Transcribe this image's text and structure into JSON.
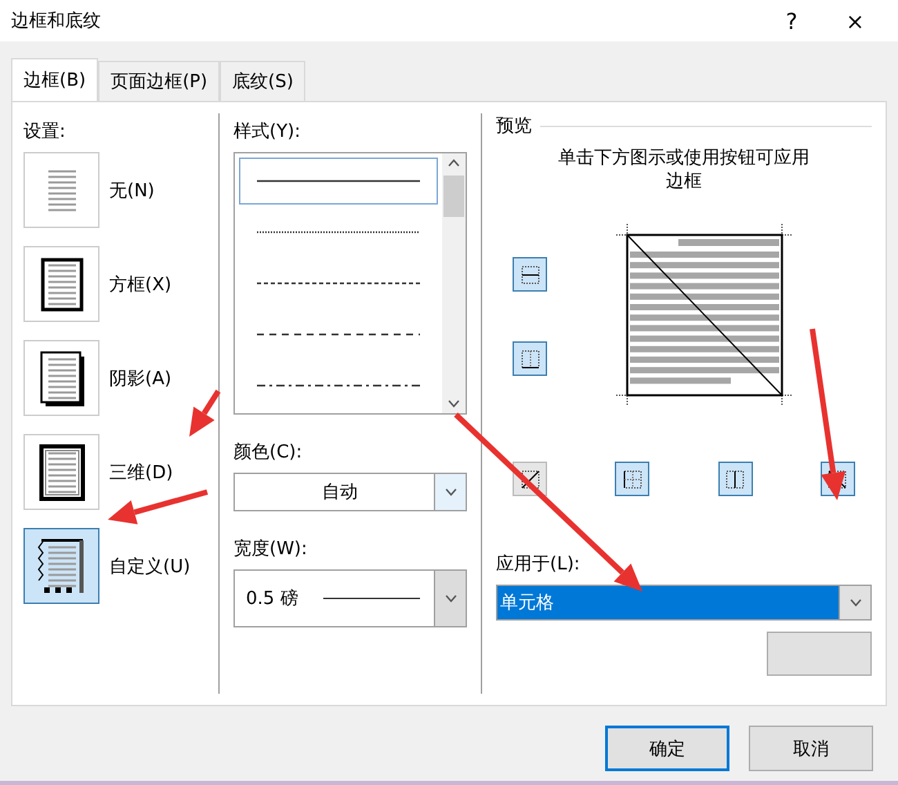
{
  "window": {
    "title": "边框和底纹",
    "help": "?",
    "close": "×"
  },
  "tabs": [
    {
      "label": "边框(B)",
      "selected": true
    },
    {
      "label": "页面边框(P)",
      "selected": false
    },
    {
      "label": "底纹(S)",
      "selected": false
    }
  ],
  "settings": {
    "label": "设置:",
    "items": [
      {
        "label": "无(N)",
        "kind": "none",
        "selected": false
      },
      {
        "label": "方框(X)",
        "kind": "box",
        "selected": false
      },
      {
        "label": "阴影(A)",
        "kind": "shadow",
        "selected": false
      },
      {
        "label": "三维(D)",
        "kind": "threed",
        "selected": false
      },
      {
        "label": "自定义(U)",
        "kind": "custom",
        "selected": true
      }
    ]
  },
  "style": {
    "label": "样式(Y):",
    "items": [
      {
        "kind": "solid",
        "selected": true
      },
      {
        "kind": "dotted",
        "selected": false
      },
      {
        "kind": "dashed-small",
        "selected": false
      },
      {
        "kind": "dashed",
        "selected": false
      },
      {
        "kind": "dash-dot",
        "selected": false
      }
    ]
  },
  "color": {
    "label": "颜色(C):",
    "value": "自动"
  },
  "width": {
    "label": "宽度(W):",
    "value": "0.5 磅"
  },
  "preview": {
    "label": "预览",
    "hint": "单击下方图示或使用按钮可应用边框",
    "buttons": [
      {
        "kind": "inner-h",
        "on": true
      },
      {
        "kind": "bottom-cross",
        "on": true
      },
      {
        "kind": "diag-up",
        "on": false
      },
      {
        "kind": "left-cross",
        "on": true
      },
      {
        "kind": "inner-v",
        "on": true
      },
      {
        "kind": "diag-down",
        "on": true
      }
    ]
  },
  "apply": {
    "label": "应用于(L):",
    "value": "单元格"
  },
  "buttons": [
    {
      "label": "确定",
      "kind": "default"
    },
    {
      "label": "取消",
      "kind": "normal"
    }
  ]
}
